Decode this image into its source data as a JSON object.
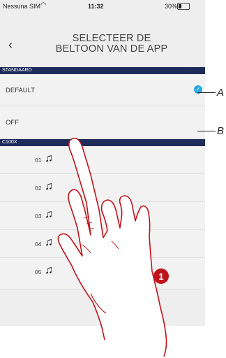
{
  "status_bar": {
    "carrier": "Nessuna SIM",
    "time": "11:32",
    "battery": "30%",
    "battery_level": 0.3
  },
  "header": {
    "back_icon": "chevron-left-icon",
    "title_line1": "SELECTEER DE",
    "title_line2": "BELTOON VAN DE APP"
  },
  "sections": [
    {
      "label": "STANDAARD",
      "items": [
        {
          "label": "DEFAULT",
          "selected": true
        },
        {
          "label": "OFF",
          "selected": false
        }
      ]
    },
    {
      "label": "C100X",
      "items": [
        {
          "label": "01",
          "icon": "music-note-icon"
        },
        {
          "label": "02",
          "icon": "music-note-icon"
        },
        {
          "label": "03",
          "icon": "music-note-icon"
        },
        {
          "label": "04",
          "icon": "music-note-icon"
        },
        {
          "label": "05",
          "icon": "music-note-icon"
        }
      ]
    }
  ],
  "callouts": {
    "a": "A",
    "b": "B",
    "step": "1"
  },
  "colors": {
    "accent": "#2aa8e0",
    "section_bg": "#1d2c5a",
    "step_badge": "#c0141c",
    "hand_outline": "#c0141c"
  }
}
